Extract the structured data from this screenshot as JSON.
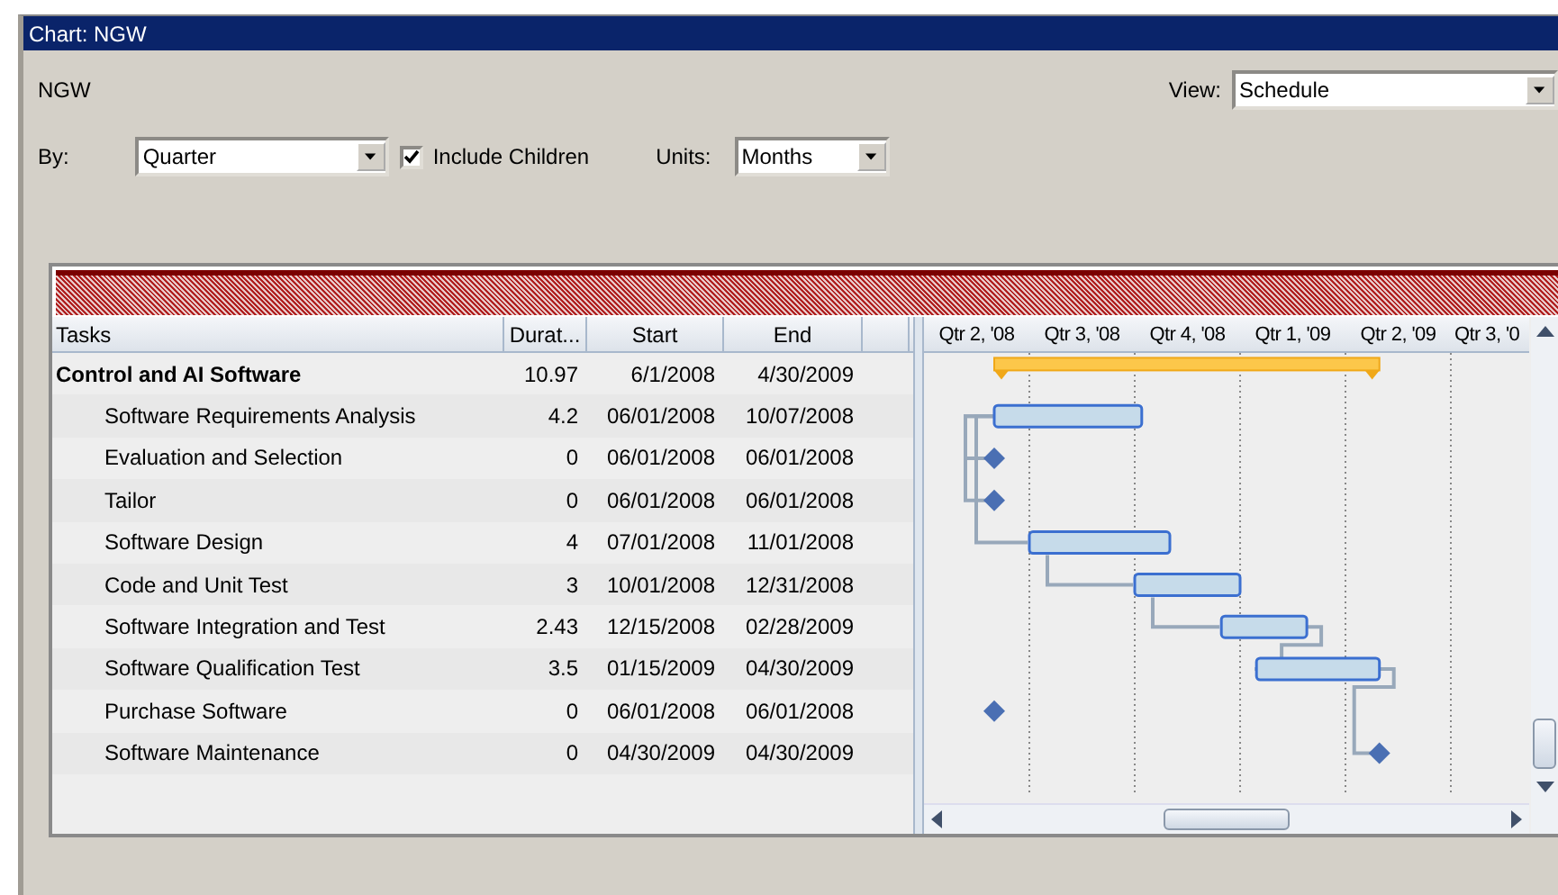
{
  "window": {
    "title": "Chart: NGW"
  },
  "project_name": "NGW",
  "view": {
    "label": "View:",
    "value": "Schedule"
  },
  "by": {
    "label": "By:",
    "value": "Quarter"
  },
  "include_children": {
    "label": "Include Children",
    "checked": true
  },
  "units": {
    "label": "Units:",
    "value": "Months"
  },
  "table": {
    "columns": [
      "Tasks",
      "Durat...",
      "Start",
      "End"
    ],
    "rows": [
      {
        "kind": "summary",
        "task": "Control and AI Software",
        "duration": "10.97",
        "start": "6/1/2008",
        "end": "4/30/2009",
        "children": [
          {
            "kind": "task",
            "task": "Software Requirements Analysis",
            "duration": "4.2",
            "start": "06/01/2008",
            "end": "10/07/2008"
          },
          {
            "kind": "milestone",
            "task": "Evaluation and Selection",
            "duration": "0",
            "start": "06/01/2008",
            "end": "06/01/2008"
          },
          {
            "kind": "milestone",
            "task": "Tailor",
            "duration": "0",
            "start": "06/01/2008",
            "end": "06/01/2008"
          },
          {
            "kind": "task",
            "task": "Software Design",
            "duration": "4",
            "start": "07/01/2008",
            "end": "11/01/2008"
          },
          {
            "kind": "task",
            "task": "Code and Unit Test",
            "duration": "3",
            "start": "10/01/2008",
            "end": "12/31/2008"
          },
          {
            "kind": "task",
            "task": "Software Integration and Test",
            "duration": "2.43",
            "start": "12/15/2008",
            "end": "02/28/2009"
          },
          {
            "kind": "task",
            "task": "Software Qualification Test",
            "duration": "3.5",
            "start": "01/15/2009",
            "end": "04/30/2009"
          },
          {
            "kind": "milestone",
            "task": "Purchase Software",
            "duration": "0",
            "start": "06/01/2008",
            "end": "06/01/2008"
          },
          {
            "kind": "milestone",
            "task": "Software Maintenance",
            "duration": "0",
            "start": "04/30/2009",
            "end": "04/30/2009"
          }
        ]
      }
    ]
  },
  "timeline": {
    "columns": [
      "Qtr 2, '08",
      "Qtr 3, '08",
      "Qtr 4, '08",
      "Qtr 1, '09",
      "Qtr 2, '09",
      "Qtr 3, '0"
    ]
  }
}
